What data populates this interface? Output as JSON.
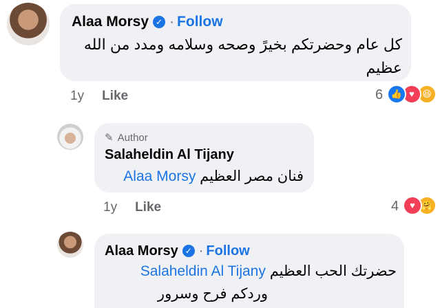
{
  "comments": [
    {
      "author": "Alaa Morsy",
      "follow_label": "Follow",
      "separator": "·",
      "text_line1": "كل عام وحضرتكم بخيرً وصحه وسلامه ومدد من الله",
      "text_line2": "عظيم",
      "age": "1y",
      "like_label": "Like",
      "reaction_count": "6",
      "reactions": [
        "like-icon",
        "love-icon",
        "haha-icon"
      ]
    },
    {
      "author_badge": "Author",
      "author": "Salaheldin Al Tijany",
      "mention": "Alaa Morsy",
      "text": "فنان مصر العظيم",
      "age": "1y",
      "like_label": "Like",
      "reaction_count": "4",
      "reactions": [
        "love-icon",
        "care-icon"
      ]
    },
    {
      "author": "Alaa Morsy",
      "follow_label": "Follow",
      "separator": "·",
      "mention": "Salaheldin Al Tijany",
      "text_line1": "حضرتك الحب العظيم",
      "text_line2": "وردكم فرح وسرور"
    }
  ],
  "colors": {
    "bubble": "#f0f1f5",
    "link": "#1b74e4",
    "muted": "#65676b",
    "love": "#f33e58",
    "haha": "#f7b125"
  }
}
